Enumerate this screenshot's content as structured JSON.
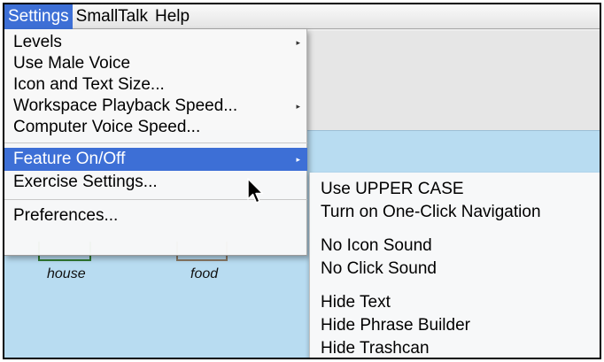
{
  "menubar": {
    "items": [
      {
        "label": "Settings",
        "active": true
      },
      {
        "label": "SmallTalk",
        "active": false
      },
      {
        "label": "Help",
        "active": false
      }
    ]
  },
  "settings_menu": {
    "items": [
      {
        "label": "Levels",
        "has_submenu": true
      },
      {
        "label": "Use Male Voice",
        "has_submenu": false
      },
      {
        "label": "Icon and Text Size...",
        "has_submenu": false
      },
      {
        "label": "Workspace Playback Speed...",
        "has_submenu": true
      },
      {
        "label": "Computer Voice Speed...",
        "has_submenu": false
      },
      {
        "label": "Feature On/Off",
        "has_submenu": true,
        "highlighted": true
      },
      {
        "label": "Exercise Settings...",
        "has_submenu": false
      },
      {
        "label": "Preferences...",
        "has_submenu": false
      }
    ],
    "submenu_arrow": "▸"
  },
  "feature_submenu": {
    "items": [
      {
        "label": "Use UPPER CASE"
      },
      {
        "label": "Turn on One-Click Navigation"
      },
      {
        "label": "No Icon Sound"
      },
      {
        "label": "No Click Sound"
      },
      {
        "label": "Hide Text"
      },
      {
        "label": "Hide Phrase Builder"
      },
      {
        "label": "Hide Trashcan"
      }
    ]
  },
  "background": {
    "tiles": [
      {
        "label": "house"
      },
      {
        "label": "food"
      }
    ]
  },
  "colors": {
    "highlight": "#3d6fd6",
    "workspace_blue": "#b8dcf1"
  }
}
